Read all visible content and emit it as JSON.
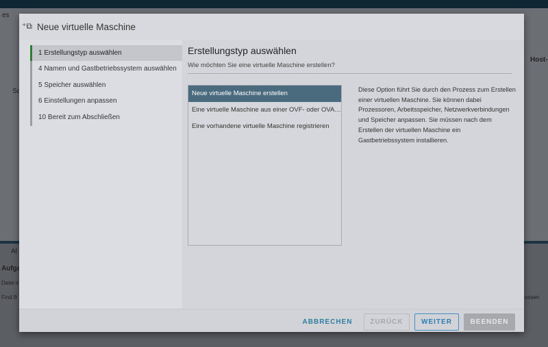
{
  "background": {
    "crumb": "es",
    "host_col": "Host-",
    "sc": "Sc",
    "al": "Al",
    "tasks": "Aufga",
    "row1": "Datei in",
    "row2": "Find B",
    "link": "ossen"
  },
  "dialog": {
    "title": "Neue virtuelle Maschine",
    "steps": [
      {
        "label": "1  Erstellungstyp auswählen",
        "active": true
      },
      {
        "label": "4  Namen und Gastbetriebssystem auswählen"
      },
      {
        "label": "5  Speicher auswählen"
      },
      {
        "label": "6  Einstellungen anpassen"
      },
      {
        "label": "10  Bereit zum Abschließen"
      }
    ],
    "heading": "Erstellungstyp auswählen",
    "subtitle": "Wie möchten Sie eine virtuelle Maschine erstellen?",
    "options": [
      "Neue virtuelle Maschine erstellen",
      "Eine virtuelle Maschine aus einer OVF- oder OVA-Datei bereitstellen",
      "Eine vorhandene virtuelle Maschine registrieren"
    ],
    "description": "Diese Option führt Sie durch den Prozess zum Erstellen einer virtuellen Maschine. Sie können dabei Prozessoren, Arbeitsspeicher, Netzwerkverbindungen und Speicher anpassen. Sie müssen nach dem Erstellen der virtuellen Maschine ein Gastbetriebssystem installieren.",
    "buttons": {
      "cancel": "ABBRECHEN",
      "back": "ZURÜCK",
      "next": "WEITER",
      "finish": "BEENDEN"
    }
  }
}
